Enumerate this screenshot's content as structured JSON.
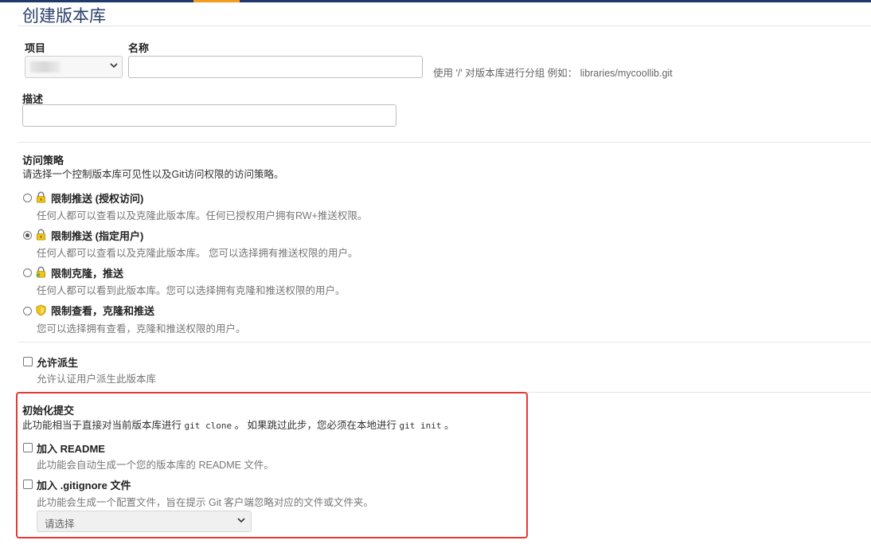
{
  "page": {
    "title": "创建版本库"
  },
  "form": {
    "project_label": "项目",
    "project_value": "",
    "name_label": "名称",
    "name_value": "",
    "name_hint": "使用 '/' 对版本库进行分组 例如： libraries/mycoollib.git",
    "description_label": "描述",
    "description_value": ""
  },
  "access": {
    "heading": "访问策略",
    "description": "请选择一个控制版本库可见性以及Git访问权限的访问策略。",
    "selected": 1,
    "options": [
      {
        "title": "限制推送 (授权访问)",
        "desc": "任何人都可以查看以及克隆此版本库。任何已授权用户拥有RW+推送权限。",
        "icon": "lock-icon",
        "icon_color": "#f0c419"
      },
      {
        "title": "限制推送 (指定用户)",
        "desc": "任何人都可以查看以及克隆此版本库。 您可以选择拥有推送权限的用户。",
        "icon": "lock-icon",
        "icon_color": "#f0c419"
      },
      {
        "title": "限制克隆，推送",
        "desc": "任何人都可以看到此版本库。您可以选择拥有克隆和推送权限的用户。",
        "icon": "lock-icon",
        "icon_color": "#4caf50"
      },
      {
        "title": "限制查看，克隆和推送",
        "desc": "您可以选择拥有查看，克隆和推送权限的用户。",
        "icon": "shield-icon",
        "icon_color": "#f0c419"
      }
    ]
  },
  "fork": {
    "title": "允许派生",
    "desc": "允许认证用户派生此版本库",
    "checked": false
  },
  "init": {
    "heading": "初始化提交",
    "desc_prefix": "此功能相当于直接对当前版本库进行 ",
    "desc_code1": "git clone",
    "desc_middle": " 。 如果跳过此步，您必须在本地进行 ",
    "desc_code2": "git init",
    "desc_suffix": " 。",
    "readme_title": "加入 README",
    "readme_desc": "此功能会自动生成一个您的版本库的 README 文件。",
    "gitignore_title": "加入 .gitignore 文件",
    "gitignore_desc": "此功能会生成一个配置文件，旨在提示 Git 客户端忽略对应的文件或文件夹。",
    "gitignore_select": "请选择"
  },
  "colors": {
    "brand_bar": "#1f3a6a",
    "accent": "#f39c1f",
    "highlight": "#e53935"
  }
}
